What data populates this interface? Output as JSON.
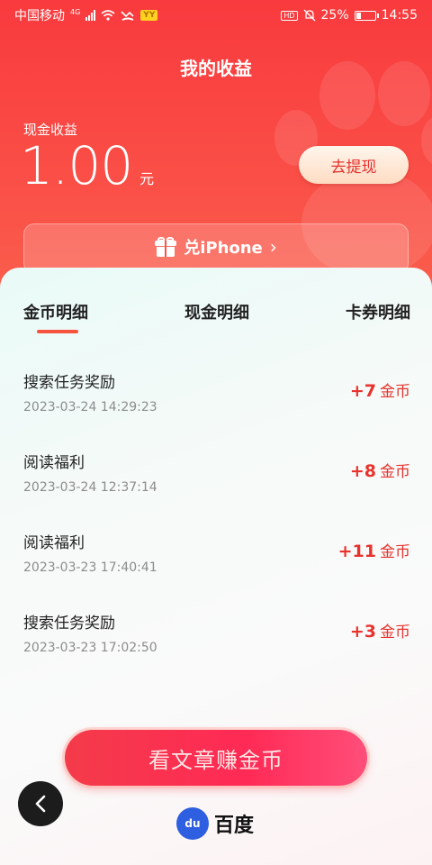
{
  "status_bar": {
    "carrier": "中国移动",
    "network": "4G",
    "battery": "25%",
    "battery_level": 0.25,
    "time": "14:55",
    "hd_badge": "HD",
    "yy_badge": "YY"
  },
  "header": {
    "title": "我的收益",
    "cash_label": "现金收益",
    "cash_value": "1.00",
    "cash_unit": "元",
    "withdraw_label": "去提现",
    "redeem_label": "兑iPhone",
    "redeem_chevron": "›"
  },
  "tabs": [
    {
      "label": "金币明细",
      "active": true
    },
    {
      "label": "现金明细",
      "active": false
    },
    {
      "label": "卡券明细",
      "active": false
    }
  ],
  "records": [
    {
      "title": "搜索任务奖励",
      "time": "2023-03-24 14:29:23",
      "amount": "+7",
      "unit": "金币"
    },
    {
      "title": "阅读福利",
      "time": "2023-03-24 12:37:14",
      "amount": "+8",
      "unit": "金币"
    },
    {
      "title": "阅读福利",
      "time": "2023-03-23 17:40:41",
      "amount": "+11",
      "unit": "金币"
    },
    {
      "title": "搜索任务奖励",
      "time": "2023-03-23 17:02:50",
      "amount": "+3",
      "unit": "金币"
    }
  ],
  "cta": {
    "label": "看文章赚金币"
  },
  "brand": {
    "logo_text": "du",
    "name": "百度"
  },
  "colors": {
    "brand_red": "#f93a3e",
    "amount_red": "#e8322d",
    "accent_underline": "#f6543e"
  },
  "icons": {
    "gift": "gift-icon",
    "back": "chevron-left-icon",
    "wifi": "wifi-icon",
    "mute": "bell-off-icon"
  }
}
